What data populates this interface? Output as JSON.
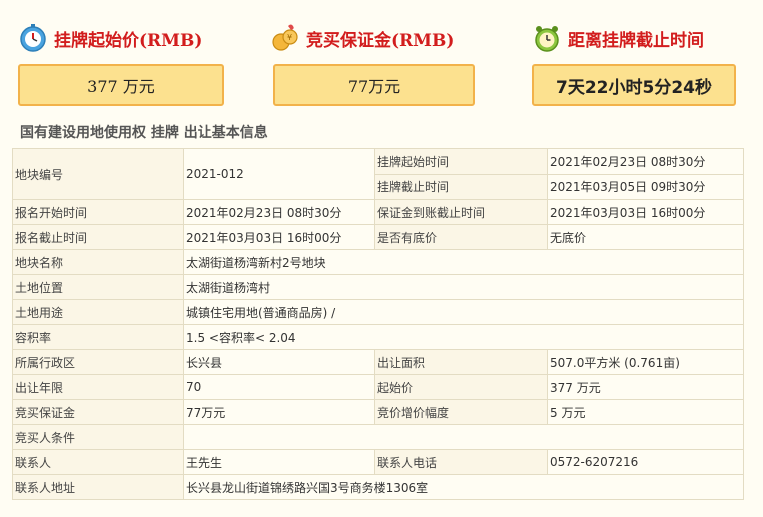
{
  "cards": [
    {
      "title": "挂牌起始价(RMB)",
      "value": "377 万元",
      "icon": "stopwatch-icon"
    },
    {
      "title": "竞买保证金(RMB)",
      "value": "77万元",
      "icon": "coins-icon"
    },
    {
      "title": "距离挂牌截止时间",
      "value": "7天22小时5分24秒",
      "icon": "alarm-clock-icon"
    }
  ],
  "section_title": "国有建设用地使用权 挂牌 出让基本信息",
  "table": {
    "plot_no_label": "地块编号",
    "plot_no": "2021-012",
    "listing_start_label": "挂牌起始时间",
    "listing_start": "2021年02月23日 08时30分",
    "listing_end_label": "挂牌截止时间",
    "listing_end": "2021年03月05日 09时30分",
    "reg_start_label": "报名开始时间",
    "reg_start": "2021年02月23日 08时30分",
    "deposit_deadline_label": "保证金到账截止时间",
    "deposit_deadline": "2021年03月03日 16时00分",
    "reg_end_label": "报名截止时间",
    "reg_end": "2021年03月03日 16时00分",
    "reserve_label": "是否有底价",
    "reserve": "无底价",
    "plot_name_label": "地块名称",
    "plot_name": "太湖街道杨湾新村2号地块",
    "location_label": "土地位置",
    "location": "太湖街道杨湾村",
    "usage_label": "土地用途",
    "usage": "城镇住宅用地(普通商品房) /",
    "far_label": "容积率",
    "far": "1.5 <容积率< 2.04",
    "district_label": "所属行政区",
    "district": "长兴县",
    "area_label": "出让面积",
    "area": "507.0平方米 (0.761亩)",
    "term_label": "出让年限",
    "term": "70",
    "start_price_label": "起始价",
    "start_price": "377 万元",
    "bid_deposit_label": "竞买保证金",
    "bid_deposit": "77万元",
    "increment_label": "竞价增价幅度",
    "increment": "5 万元",
    "conditions_label": "竞买人条件",
    "conditions": "",
    "contact_label": "联系人",
    "contact": "王先生",
    "phone_label": "联系人电话",
    "phone": "0572-6207216",
    "address_label": "联系人地址",
    "address": "长兴县龙山街道锦绣路兴国3号商务楼1306室"
  }
}
